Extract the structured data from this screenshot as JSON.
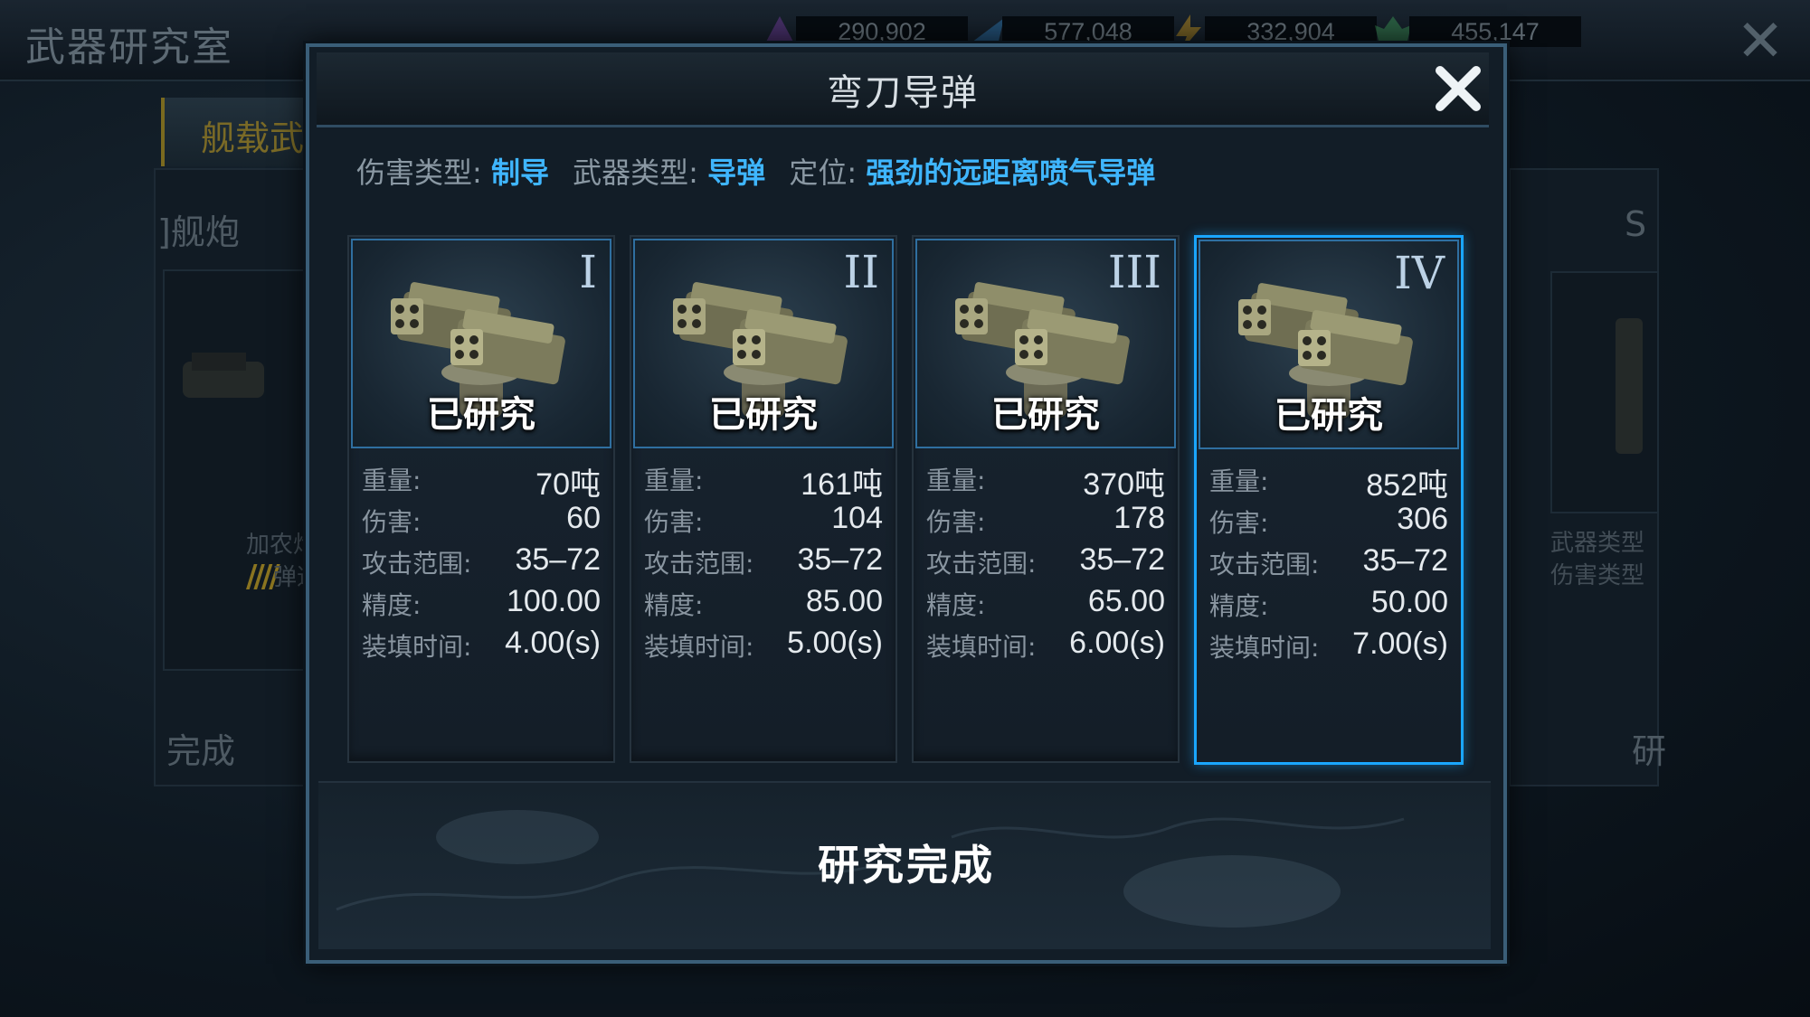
{
  "background": {
    "screen_title": "武器研究室",
    "resources": [
      {
        "icon": "purple-crystal-icon",
        "value": "290,902"
      },
      {
        "icon": "blue-fuel-icon",
        "value": "577,048"
      },
      {
        "icon": "energy-bolt-icon",
        "value": "332,904"
      },
      {
        "icon": "green-ore-icon",
        "value": "455,147"
      }
    ],
    "tab_label": "舰载武",
    "left_panel": {
      "header": "]舰炮",
      "desc_line1": "加农炮",
      "desc_line2": "弹道",
      "status": "完成"
    },
    "right_panel": {
      "header": "S",
      "desc_line1": "武器类型",
      "desc_line2": "伤害类型",
      "status": "研"
    }
  },
  "modal": {
    "title": "弯刀导弹",
    "info": {
      "damage_type_label": "伤害类型:",
      "damage_type_value": "制导",
      "weapon_type_label": "武器类型:",
      "weapon_type_value": "导弹",
      "role_label": "定位:",
      "role_value": "强劲的远距离喷气导弹"
    },
    "cards": [
      {
        "tier": "I",
        "status": "已研究",
        "stats": [
          {
            "k": "重量:",
            "v": "70吨"
          },
          {
            "k": "伤害:",
            "v": "60"
          },
          {
            "k": "攻击范围:",
            "v": "35–72"
          },
          {
            "k": "精度:",
            "v": "100.00"
          },
          {
            "k": "装填时间:",
            "v": "4.00(s)"
          }
        ]
      },
      {
        "tier": "II",
        "status": "已研究",
        "stats": [
          {
            "k": "重量:",
            "v": "161吨"
          },
          {
            "k": "伤害:",
            "v": "104"
          },
          {
            "k": "攻击范围:",
            "v": "35–72"
          },
          {
            "k": "精度:",
            "v": "85.00"
          },
          {
            "k": "装填时间:",
            "v": "5.00(s)"
          }
        ]
      },
      {
        "tier": "III",
        "status": "已研究",
        "stats": [
          {
            "k": "重量:",
            "v": "370吨"
          },
          {
            "k": "伤害:",
            "v": "178"
          },
          {
            "k": "攻击范围:",
            "v": "35–72"
          },
          {
            "k": "精度:",
            "v": "65.00"
          },
          {
            "k": "装填时间:",
            "v": "6.00(s)"
          }
        ]
      },
      {
        "tier": "IV",
        "status": "已研究",
        "stats": [
          {
            "k": "重量:",
            "v": "852吨"
          },
          {
            "k": "伤害:",
            "v": "306"
          },
          {
            "k": "攻击范围:",
            "v": "35–72"
          },
          {
            "k": "精度:",
            "v": "50.00"
          },
          {
            "k": "装填时间:",
            "v": "7.00(s)"
          }
        ]
      }
    ],
    "selected_card": 3,
    "complete_label": "研究完成"
  },
  "colors": {
    "accent_blue": "#1aa6ff",
    "info_value": "#3fb6ff",
    "frame": "#3a5e78"
  }
}
